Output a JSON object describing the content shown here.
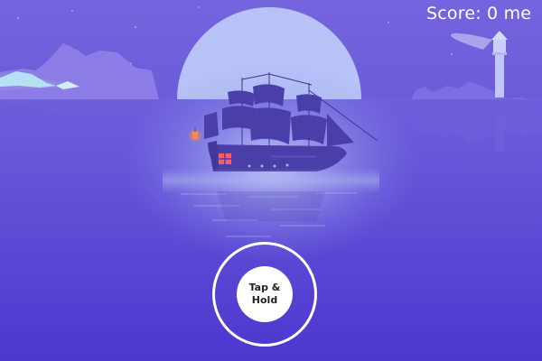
{
  "hud": {
    "score_text": "Score: 0 me"
  },
  "controls": {
    "tap_label_line1": "Tap &",
    "tap_label_line2": "Hold"
  },
  "colors": {
    "sky_top": "#6f5fdc",
    "sea": "#5a48d4",
    "moon": "#b7c3f6",
    "ship": "#4a3fa8",
    "lantern": "#ff8a3d"
  },
  "icons": [
    "sailing-ship",
    "lighthouse",
    "moon"
  ]
}
